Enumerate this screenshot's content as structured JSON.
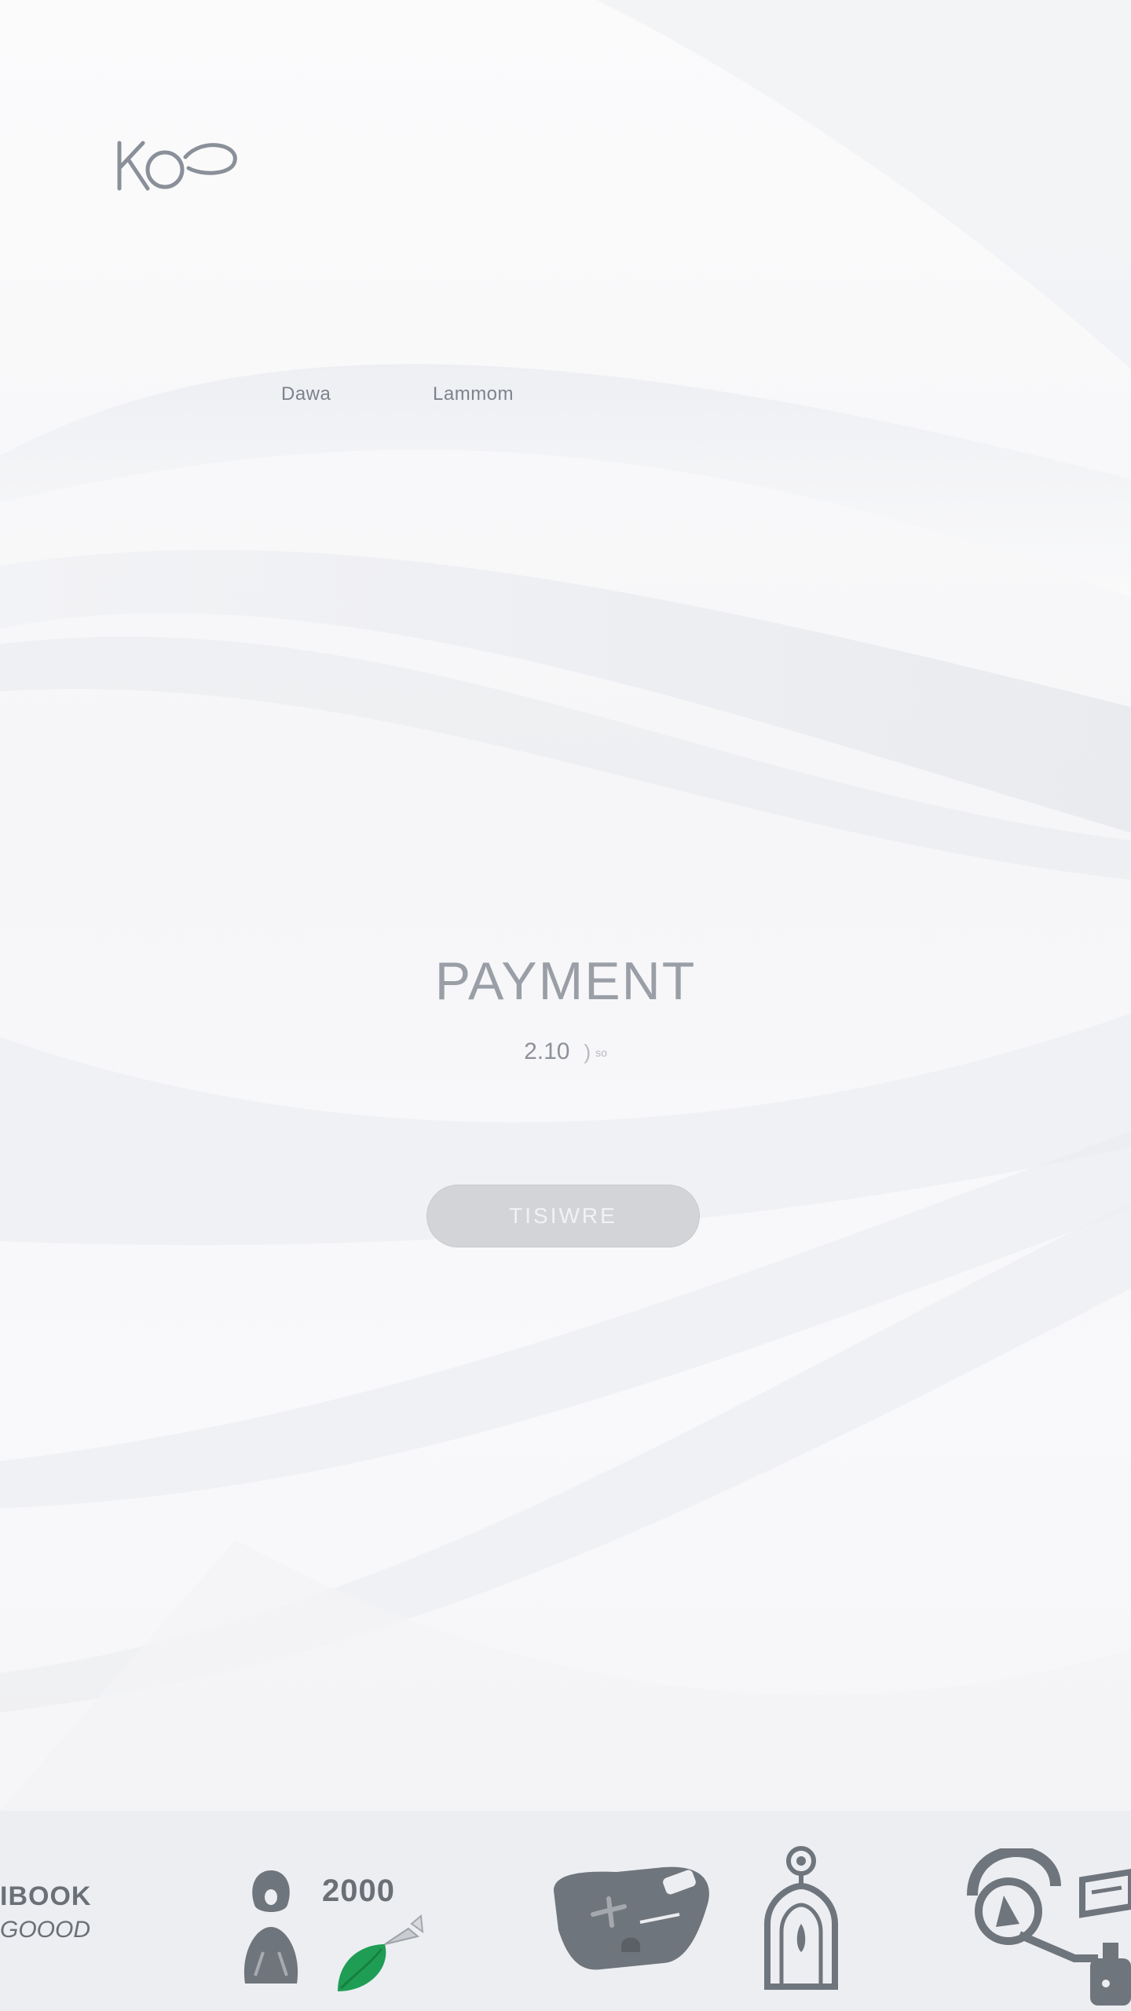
{
  "brand": {
    "logo_text": "KOP"
  },
  "nav": {
    "items": [
      {
        "label": "Dawa"
      },
      {
        "label": "Lammom"
      }
    ]
  },
  "hero": {
    "title": "PAYMENT",
    "subtitle_value": "2.10",
    "subtitle_arrow": ")",
    "subtitle_unit": "so"
  },
  "cta": {
    "label": "TISIWRE"
  },
  "footer": {
    "brand_line1": "IBOOK",
    "brand_line2": "GOOOD",
    "count_label": "2000",
    "icons": [
      "person-icon",
      "leaf-icon",
      "gamepad-icon",
      "lock-tower-icon",
      "headset-icon"
    ]
  },
  "colors": {
    "accent_green": "#1f9d55",
    "icon_gray": "#6f757c",
    "button_fill": "#d3d4d8"
  }
}
